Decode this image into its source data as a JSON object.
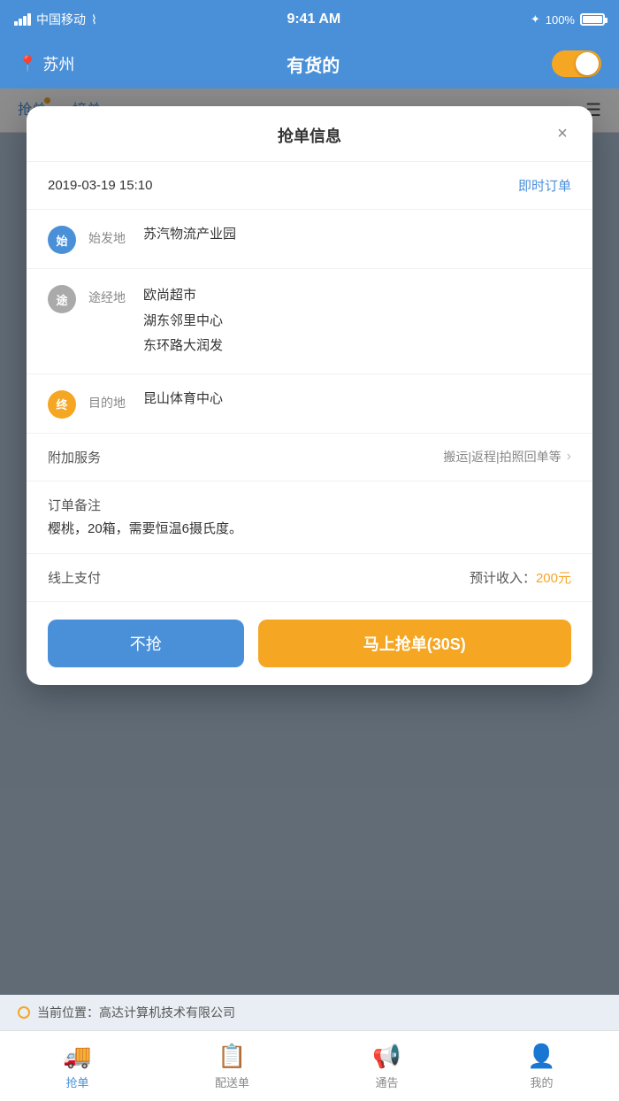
{
  "statusBar": {
    "carrier": "中国移动",
    "wifi": "wifi",
    "time": "9:41 AM",
    "bluetooth": "bluetooth",
    "battery": "100%"
  },
  "header": {
    "location": "苏州",
    "title": "有货的",
    "toggle": true
  },
  "bgTabs": {
    "tab1": "抢单",
    "tab2": "接单"
  },
  "modal": {
    "title": "抢单信息",
    "close": "×",
    "datetime": "2019-03-19 15:10",
    "orderType": "即时订单",
    "origin": {
      "label": "始发地",
      "icon": "始",
      "name": "苏汽物流产业园"
    },
    "via": {
      "label": "途经地",
      "icon": "途",
      "stops": [
        "欧尚超市",
        "湖东邻里中心",
        "东环路大润发"
      ]
    },
    "destination": {
      "label": "目的地",
      "icon": "终",
      "name": "昆山体育中心"
    },
    "service": {
      "label": "附加服务",
      "value": "搬运|返程|拍照回单等"
    },
    "notes": {
      "label": "订单备注",
      "content": "樱桃，20箱，需要恒温6摄氏度。"
    },
    "payment": {
      "label": "线上支付",
      "estimateLabel": "预计收入：",
      "amount": "200元"
    },
    "btnDecline": "不抢",
    "btnGrab": "马上抢单(30S)"
  },
  "bottomBar": {
    "locationLabel": "当前位置：高达计算机技术有限公司"
  },
  "nav": {
    "items": [
      {
        "id": "grab",
        "label": "抢单",
        "active": true
      },
      {
        "id": "delivery",
        "label": "配送单",
        "active": false
      },
      {
        "id": "notice",
        "label": "通告",
        "active": false
      },
      {
        "id": "mine",
        "label": "我的",
        "active": false
      }
    ]
  }
}
